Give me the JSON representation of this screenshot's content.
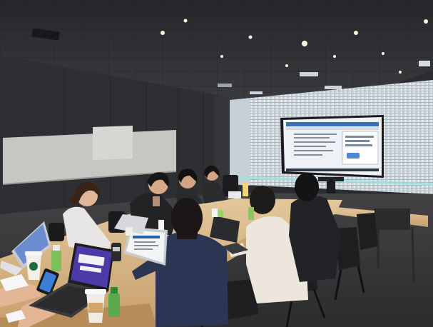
{
  "image": {
    "subject": "meeting-room",
    "colors": {
      "ceiling": "#2e2f33",
      "wall_dark": "#2f3033",
      "whiteboard": "#c9c7c3",
      "window_blinds": "#dfe6ea",
      "table_wood": "#d7b98a",
      "carpet": "#3a3a3c",
      "screen_glow": "#eef2f6"
    }
  }
}
